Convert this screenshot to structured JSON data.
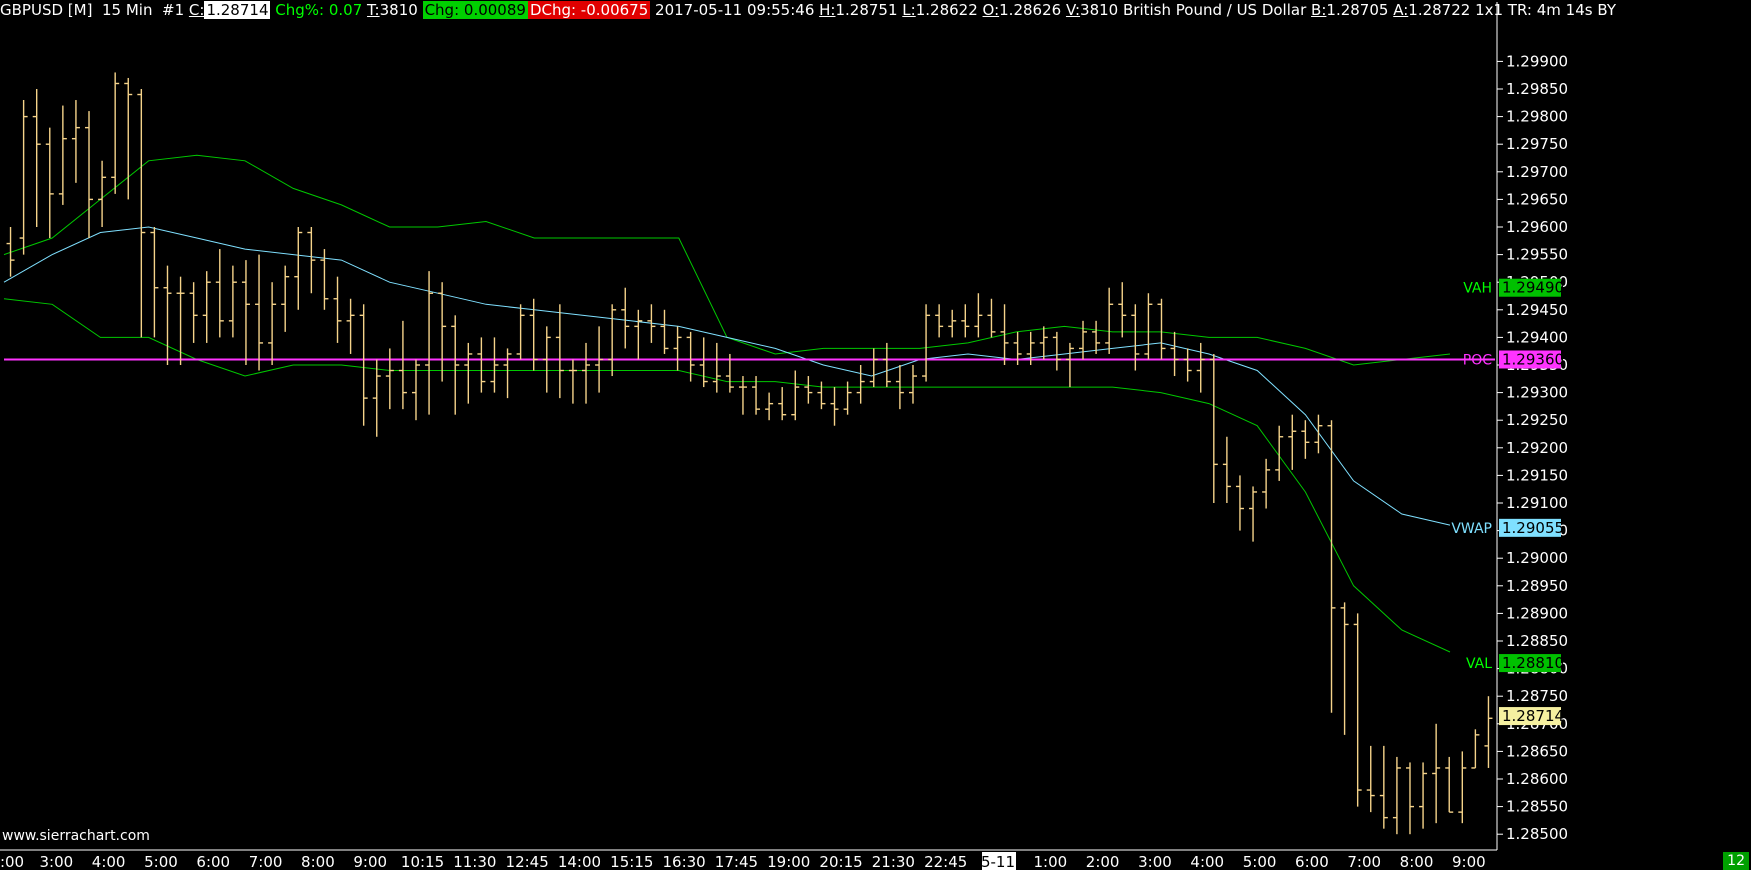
{
  "header": {
    "symbol": "GBPUSD [M]",
    "timeframe": "15 Min",
    "chart_num": "#1",
    "close_key": "C:",
    "close_val": "1.28714",
    "chgpct_label": "Chg%: 0.07",
    "trades_key": "T:",
    "trades_val": "3810",
    "chg_label": "Chg: 0.00089",
    "dchg_label": "DChg: -0.00675",
    "datetime": "2017-05-11 09:55:46",
    "high_key": "H:",
    "high_val": "1.28751",
    "low_key": "L:",
    "low_val": "1.28622",
    "open_key": "O:",
    "open_val": "1.28626",
    "vol_key": "V:",
    "vol_val": "3810 British Pound / US Dollar",
    "bid_key": "B:",
    "bid_val": "1.28705",
    "ask_key": "A:",
    "ask_val": "1.28722 1x1 TR: 4m 14s",
    "trail": "BY"
  },
  "watermark": "www.sierrachart.com",
  "corner_badge": "12",
  "colors": {
    "background": "#000000",
    "bar": "#f5d38a",
    "band": "#00c800",
    "vwap": "#7fe0ff",
    "poc": "#ff33ff",
    "text": "#ffffff"
  },
  "chart_data": {
    "type": "ohlc",
    "y_axis": {
      "min": 1.28475,
      "max": 1.29975,
      "ticks": [
        "1.29900",
        "1.29850",
        "1.29800",
        "1.29750",
        "1.29700",
        "1.29650",
        "1.29600",
        "1.29550",
        "1.29500",
        "1.29450",
        "1.29400",
        "1.29350",
        "1.29300",
        "1.29250",
        "1.29200",
        "1.29150",
        "1.29100",
        "1.29050",
        "1.29000",
        "1.28950",
        "1.28900",
        "1.28850",
        "1.28800",
        "1.28750",
        "1.28700",
        "1.28650",
        "1.28600",
        "1.28550",
        "1.28500"
      ]
    },
    "x_axis": {
      "labels": [
        ":00",
        "3:00",
        "4:00",
        "5:00",
        "6:00",
        "7:00",
        "8:00",
        "9:00",
        "10:15",
        "11:30",
        "12:45",
        "14:00",
        "15:15",
        "16:30",
        "17:45",
        "19:00",
        "20:15",
        "21:30",
        "22:45",
        "5-11",
        "1:00",
        "2:00",
        "3:00",
        "4:00",
        "5:00",
        "6:00",
        "7:00",
        "8:00",
        "9:00"
      ],
      "highlight": "5-11"
    },
    "ohlc": [
      [
        1.2957,
        1.296,
        1.2951,
        1.2954
      ],
      [
        1.2958,
        1.2983,
        1.2955,
        1.298
      ],
      [
        1.298,
        1.2985,
        1.296,
        1.2975
      ],
      [
        1.2975,
        1.2978,
        1.2958,
        1.2966
      ],
      [
        1.2966,
        1.2982,
        1.2964,
        1.2976
      ],
      [
        1.2976,
        1.2983,
        1.2968,
        1.2978
      ],
      [
        1.2978,
        1.2981,
        1.2958,
        1.2965
      ],
      [
        1.2965,
        1.2972,
        1.296,
        1.2969
      ],
      [
        1.2969,
        1.2988,
        1.2966,
        1.2986
      ],
      [
        1.2986,
        1.2987,
        1.2965,
        1.2984
      ],
      [
        1.2984,
        1.2985,
        1.294,
        1.2959
      ],
      [
        1.2959,
        1.296,
        1.294,
        1.2949
      ],
      [
        1.2949,
        1.2953,
        1.2935,
        1.2948
      ],
      [
        1.2948,
        1.2951,
        1.2935,
        1.2948
      ],
      [
        1.2948,
        1.295,
        1.2939,
        1.2944
      ],
      [
        1.2944,
        1.2952,
        1.2939,
        1.295
      ],
      [
        1.295,
        1.2956,
        1.294,
        1.2943
      ],
      [
        1.2943,
        1.2953,
        1.294,
        1.295
      ],
      [
        1.295,
        1.2954,
        1.2935,
        1.2946
      ],
      [
        1.2946,
        1.2955,
        1.2934,
        1.2939
      ],
      [
        1.2939,
        1.295,
        1.2935,
        1.2946
      ],
      [
        1.2946,
        1.2953,
        1.2941,
        1.2951
      ],
      [
        1.2951,
        1.296,
        1.2945,
        1.2959
      ],
      [
        1.2959,
        1.296,
        1.2948,
        1.2954
      ],
      [
        1.2954,
        1.2956,
        1.2945,
        1.2947
      ],
      [
        1.2947,
        1.2951,
        1.2939,
        1.2943
      ],
      [
        1.2943,
        1.2947,
        1.2937,
        1.2944
      ],
      [
        1.2944,
        1.2946,
        1.2924,
        1.2929
      ],
      [
        1.2929,
        1.2936,
        1.2922,
        1.2933
      ],
      [
        1.2933,
        1.2938,
        1.2927,
        1.2934
      ],
      [
        1.2934,
        1.2943,
        1.2927,
        1.293
      ],
      [
        1.293,
        1.2936,
        1.2925,
        1.2935
      ],
      [
        1.2935,
        1.2952,
        1.2926,
        1.2948
      ],
      [
        1.2948,
        1.295,
        1.2932,
        1.2942
      ],
      [
        1.2942,
        1.2944,
        1.2926,
        1.2935
      ],
      [
        1.2935,
        1.2939,
        1.2928,
        1.2937
      ],
      [
        1.2937,
        1.294,
        1.293,
        1.2932
      ],
      [
        1.2932,
        1.294,
        1.293,
        1.2935
      ],
      [
        1.2935,
        1.2938,
        1.2929,
        1.2937
      ],
      [
        1.2937,
        1.2946,
        1.2936,
        1.2944
      ],
      [
        1.2944,
        1.2947,
        1.2934,
        1.2936
      ],
      [
        1.2936,
        1.2942,
        1.293,
        1.294
      ],
      [
        1.294,
        1.2946,
        1.2929,
        1.2934
      ],
      [
        1.2934,
        1.2936,
        1.2928,
        1.2934
      ],
      [
        1.2934,
        1.2939,
        1.2928,
        1.2935
      ],
      [
        1.2935,
        1.2942,
        1.293,
        1.2936
      ],
      [
        1.2936,
        1.2946,
        1.2933,
        1.2945
      ],
      [
        1.2945,
        1.2949,
        1.2938,
        1.2942
      ],
      [
        1.2942,
        1.2945,
        1.2936,
        1.2943
      ],
      [
        1.2943,
        1.2946,
        1.2939,
        1.2942
      ],
      [
        1.2942,
        1.2945,
        1.2937,
        1.2938
      ],
      [
        1.2938,
        1.2942,
        1.2934,
        1.294
      ],
      [
        1.294,
        1.2941,
        1.2932,
        1.2935
      ],
      [
        1.2935,
        1.294,
        1.2931,
        1.2932
      ],
      [
        1.2932,
        1.2939,
        1.293,
        1.2933
      ],
      [
        1.2933,
        1.2937,
        1.293,
        1.2931
      ],
      [
        1.2931,
        1.2933,
        1.2926,
        1.2931
      ],
      [
        1.2931,
        1.2933,
        1.2926,
        1.2927
      ],
      [
        1.2927,
        1.293,
        1.2925,
        1.2928
      ],
      [
        1.2928,
        1.2931,
        1.2925,
        1.2926
      ],
      [
        1.2926,
        1.2934,
        1.2925,
        1.2931
      ],
      [
        1.2931,
        1.2933,
        1.2928,
        1.293
      ],
      [
        1.293,
        1.2932,
        1.2927,
        1.2928
      ],
      [
        1.2928,
        1.2931,
        1.2924,
        1.2927
      ],
      [
        1.2927,
        1.2932,
        1.2926,
        1.293
      ],
      [
        1.293,
        1.2935,
        1.2928,
        1.2932
      ],
      [
        1.2932,
        1.2938,
        1.2931,
        1.2936
      ],
      [
        1.2936,
        1.2939,
        1.2931,
        1.2932
      ],
      [
        1.2932,
        1.2935,
        1.2927,
        1.293
      ],
      [
        1.293,
        1.2935,
        1.2928,
        1.2933
      ],
      [
        1.2933,
        1.2946,
        1.2932,
        1.2944
      ],
      [
        1.2944,
        1.2946,
        1.294,
        1.2942
      ],
      [
        1.2942,
        1.2945,
        1.294,
        1.2943
      ],
      [
        1.2943,
        1.2946,
        1.294,
        1.2942
      ],
      [
        1.2942,
        1.2948,
        1.294,
        1.2944
      ],
      [
        1.2944,
        1.2947,
        1.294,
        1.2941
      ],
      [
        1.2941,
        1.2946,
        1.2935,
        1.2939
      ],
      [
        1.2939,
        1.2941,
        1.2935,
        1.2937
      ],
      [
        1.2937,
        1.2941,
        1.2935,
        1.2939
      ],
      [
        1.2939,
        1.2942,
        1.2936,
        1.294
      ],
      [
        1.294,
        1.2941,
        1.2934,
        1.2936
      ],
      [
        1.2936,
        1.2939,
        1.2931,
        1.2938
      ],
      [
        1.2938,
        1.2943,
        1.2936,
        1.2941
      ],
      [
        1.2941,
        1.2943,
        1.2937,
        1.2939
      ],
      [
        1.2939,
        1.2949,
        1.2937,
        1.2946
      ],
      [
        1.2946,
        1.295,
        1.294,
        1.2944
      ],
      [
        1.2944,
        1.2946,
        1.2934,
        1.2937
      ],
      [
        1.2937,
        1.2948,
        1.2936,
        1.2946
      ],
      [
        1.2946,
        1.2947,
        1.2936,
        1.2938
      ],
      [
        1.2938,
        1.2941,
        1.2933,
        1.2936
      ],
      [
        1.2936,
        1.2938,
        1.2932,
        1.2934
      ],
      [
        1.2934,
        1.2939,
        1.293,
        1.2936
      ],
      [
        1.2936,
        1.2937,
        1.291,
        1.2917
      ],
      [
        1.2917,
        1.2922,
        1.291,
        1.2913
      ],
      [
        1.2913,
        1.2915,
        1.2905,
        1.2909
      ],
      [
        1.2909,
        1.2913,
        1.2903,
        1.2912
      ],
      [
        1.2912,
        1.2918,
        1.2909,
        1.2916
      ],
      [
        1.2916,
        1.2924,
        1.2914,
        1.2922
      ],
      [
        1.2922,
        1.2926,
        1.2916,
        1.2923
      ],
      [
        1.2923,
        1.2925,
        1.2918,
        1.2921
      ],
      [
        1.2921,
        1.2926,
        1.2919,
        1.2924
      ],
      [
        1.2924,
        1.2925,
        1.2872,
        1.2891
      ],
      [
        1.2891,
        1.2892,
        1.2868,
        1.2888
      ],
      [
        1.2888,
        1.289,
        1.2855,
        1.2858
      ],
      [
        1.2858,
        1.2866,
        1.2854,
        1.2857
      ],
      [
        1.2857,
        1.2866,
        1.2851,
        1.2853
      ],
      [
        1.2853,
        1.2864,
        1.285,
        1.2862
      ],
      [
        1.2862,
        1.2863,
        1.285,
        1.2855
      ],
      [
        1.2855,
        1.2863,
        1.2851,
        1.2861
      ],
      [
        1.2861,
        1.287,
        1.2852,
        1.2862
      ],
      [
        1.2862,
        1.2864,
        1.2854,
        1.2854
      ],
      [
        1.2854,
        1.2865,
        1.2852,
        1.2862
      ],
      [
        1.2862,
        1.2869,
        1.2862,
        1.2868
      ],
      [
        1.2866,
        1.2875,
        1.2862,
        1.2871
      ]
    ],
    "vwap": [
      1.295,
      1.2955,
      1.2959,
      1.296,
      1.2958,
      1.2956,
      1.2955,
      1.2954,
      1.295,
      1.2948,
      1.2946,
      1.2945,
      1.2944,
      1.2943,
      1.2942,
      1.294,
      1.2938,
      1.2935,
      1.2933,
      1.2936,
      1.2937,
      1.2936,
      1.2937,
      1.2938,
      1.2939,
      1.2937,
      1.2934,
      1.2926,
      1.2914,
      1.2908,
      1.2906
    ],
    "upper_band": [
      1.2955,
      1.2958,
      1.2965,
      1.2972,
      1.2973,
      1.2972,
      1.2967,
      1.2964,
      1.296,
      1.296,
      1.2961,
      1.2958,
      1.2958,
      1.2958,
      1.2958,
      1.294,
      1.2937,
      1.2938,
      1.2938,
      1.2938,
      1.2939,
      1.2941,
      1.2942,
      1.2941,
      1.2941,
      1.294,
      1.294,
      1.2938,
      1.2935,
      1.2936,
      1.2937
    ],
    "lower_band": [
      1.2947,
      1.2946,
      1.294,
      1.294,
      1.2936,
      1.2933,
      1.2935,
      1.2935,
      1.2934,
      1.2934,
      1.2934,
      1.2934,
      1.2934,
      1.2934,
      1.2934,
      1.2932,
      1.2932,
      1.2931,
      1.2931,
      1.2931,
      1.2931,
      1.2931,
      1.2931,
      1.2931,
      1.293,
      1.2928,
      1.2924,
      1.2912,
      1.2895,
      1.2887,
      1.2883
    ],
    "value_area_high": 1.2949,
    "poc": 1.2936,
    "value_area_low": 1.2881,
    "vwap_last": 1.29055,
    "last_price": 1.28714,
    "level_labels": {
      "VAH": "VAH",
      "VAH_val": "1.29490",
      "POC": "POC",
      "POC_val": "1.29360",
      "VWAP": "VWAP",
      "VWAP_val": "1.29055",
      "VAL": "VAL",
      "VAL_val": "1.28810",
      "LAST_val": "1.28714"
    }
  }
}
